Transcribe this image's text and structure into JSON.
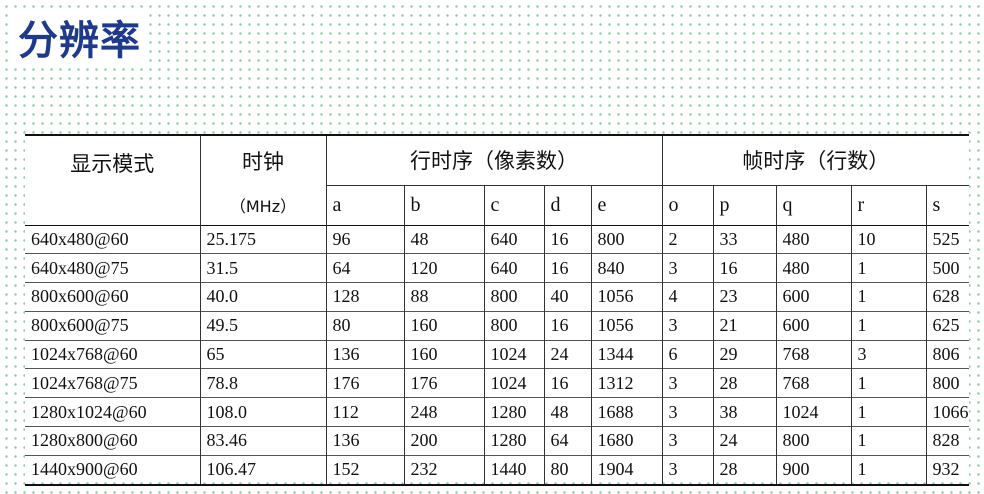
{
  "title": "分辨率",
  "table": {
    "headers": {
      "mode": "显示模式",
      "clock": "时钟",
      "clock_unit": "（MHz）",
      "line_timing": "行时序（像素数）",
      "frame_timing": "帧时序（行数）",
      "line_cols": [
        "a",
        "b",
        "c",
        "d",
        "e"
      ],
      "frame_cols": [
        "o",
        "p",
        "q",
        "r",
        "s"
      ]
    },
    "rows": [
      [
        "640x480@60",
        "25.175",
        "96",
        "48",
        "640",
        "16",
        "800",
        "2",
        "33",
        "480",
        "10",
        "525"
      ],
      [
        "640x480@75",
        "31.5",
        "64",
        "120",
        "640",
        "16",
        "840",
        "3",
        "16",
        "480",
        "1",
        "500"
      ],
      [
        "800x600@60",
        "40.0",
        "128",
        "88",
        "800",
        "40",
        "1056",
        "4",
        "23",
        "600",
        "1",
        "628"
      ],
      [
        "800x600@75",
        "49.5",
        "80",
        "160",
        "800",
        "16",
        "1056",
        "3",
        "21",
        "600",
        "1",
        "625"
      ],
      [
        "1024x768@60",
        "65",
        "136",
        "160",
        "1024",
        "24",
        "1344",
        "6",
        "29",
        "768",
        "3",
        "806"
      ],
      [
        "1024x768@75",
        "78.8",
        "176",
        "176",
        "1024",
        "16",
        "1312",
        "3",
        "28",
        "768",
        "1",
        "800"
      ],
      [
        "1280x1024@60",
        "108.0",
        "112",
        "248",
        "1280",
        "48",
        "1688",
        "3",
        "38",
        "1024",
        "1",
        "1066"
      ],
      [
        "1280x800@60",
        "83.46",
        "136",
        "200",
        "1280",
        "64",
        "1680",
        "3",
        "24",
        "800",
        "1",
        "828"
      ],
      [
        "1440x900@60",
        "106.47",
        "152",
        "232",
        "1440",
        "80",
        "1904",
        "3",
        "28",
        "900",
        "1",
        "932"
      ]
    ]
  },
  "colors": {
    "title": "#1f3a8a",
    "dots": "#8fc9a6"
  }
}
